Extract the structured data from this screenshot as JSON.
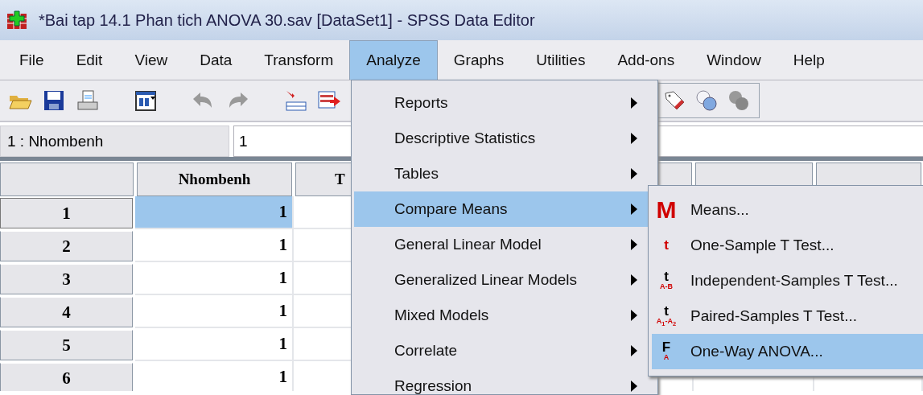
{
  "window": {
    "title": "*Bai tap 14.1 Phan tich ANOVA 30.sav [DataSet1] - SPSS Data Editor"
  },
  "menubar": [
    {
      "label": "File",
      "selected": false
    },
    {
      "label": "Edit",
      "selected": false
    },
    {
      "label": "View",
      "selected": false
    },
    {
      "label": "Data",
      "selected": false
    },
    {
      "label": "Transform",
      "selected": false
    },
    {
      "label": "Analyze",
      "selected": true
    },
    {
      "label": "Graphs",
      "selected": false
    },
    {
      "label": "Utilities",
      "selected": false
    },
    {
      "label": "Add-ons",
      "selected": false
    },
    {
      "label": "Window",
      "selected": false
    },
    {
      "label": "Help",
      "selected": false
    }
  ],
  "cell_editor": {
    "variable": "1 : Nhombenh",
    "value": "1"
  },
  "grid": {
    "columns": [
      "Nhombenh",
      "T"
    ],
    "rows": [
      {
        "header": "1",
        "value": "1",
        "selected": true
      },
      {
        "header": "2",
        "value": "1",
        "selected": false
      },
      {
        "header": "3",
        "value": "1",
        "selected": false
      },
      {
        "header": "4",
        "value": "1",
        "selected": false
      },
      {
        "header": "5",
        "value": "1",
        "selected": false
      },
      {
        "header": "6",
        "value": "1",
        "selected": false
      }
    ]
  },
  "analyze_menu": {
    "items": [
      {
        "label": "Reports",
        "submenu": true,
        "selected": false
      },
      {
        "label": "Descriptive Statistics",
        "submenu": true,
        "selected": false
      },
      {
        "label": "Tables",
        "submenu": true,
        "selected": false
      },
      {
        "label": "Compare Means",
        "submenu": true,
        "selected": true
      },
      {
        "label": "General Linear Model",
        "submenu": true,
        "selected": false
      },
      {
        "label": "Generalized Linear Models",
        "submenu": true,
        "selected": false
      },
      {
        "label": "Mixed Models",
        "submenu": true,
        "selected": false
      },
      {
        "label": "Correlate",
        "submenu": true,
        "selected": false
      },
      {
        "label": "Regression",
        "submenu": true,
        "selected": false
      }
    ]
  },
  "compare_means_menu": {
    "items": [
      {
        "label": "Means...",
        "kind": "means",
        "icon": {
          "main": "M"
        },
        "selected": false
      },
      {
        "label": "One-Sample T Test...",
        "kind": "t",
        "icon": {
          "main": "t"
        },
        "selected": false
      },
      {
        "label": "Independent-Samples T Test...",
        "kind": "t-sub",
        "icon": {
          "main": "t",
          "sub": "A-B"
        },
        "selected": false
      },
      {
        "label": "Paired-Samples T Test...",
        "kind": "t-sub",
        "icon": {
          "main": "t",
          "sub": "A$_{1}$-A$_{2}$"
        },
        "selected": false
      },
      {
        "label": "One-Way ANOVA...",
        "kind": "f-sub",
        "icon": {
          "main": "F",
          "sub": "A"
        },
        "selected": true
      }
    ]
  }
}
